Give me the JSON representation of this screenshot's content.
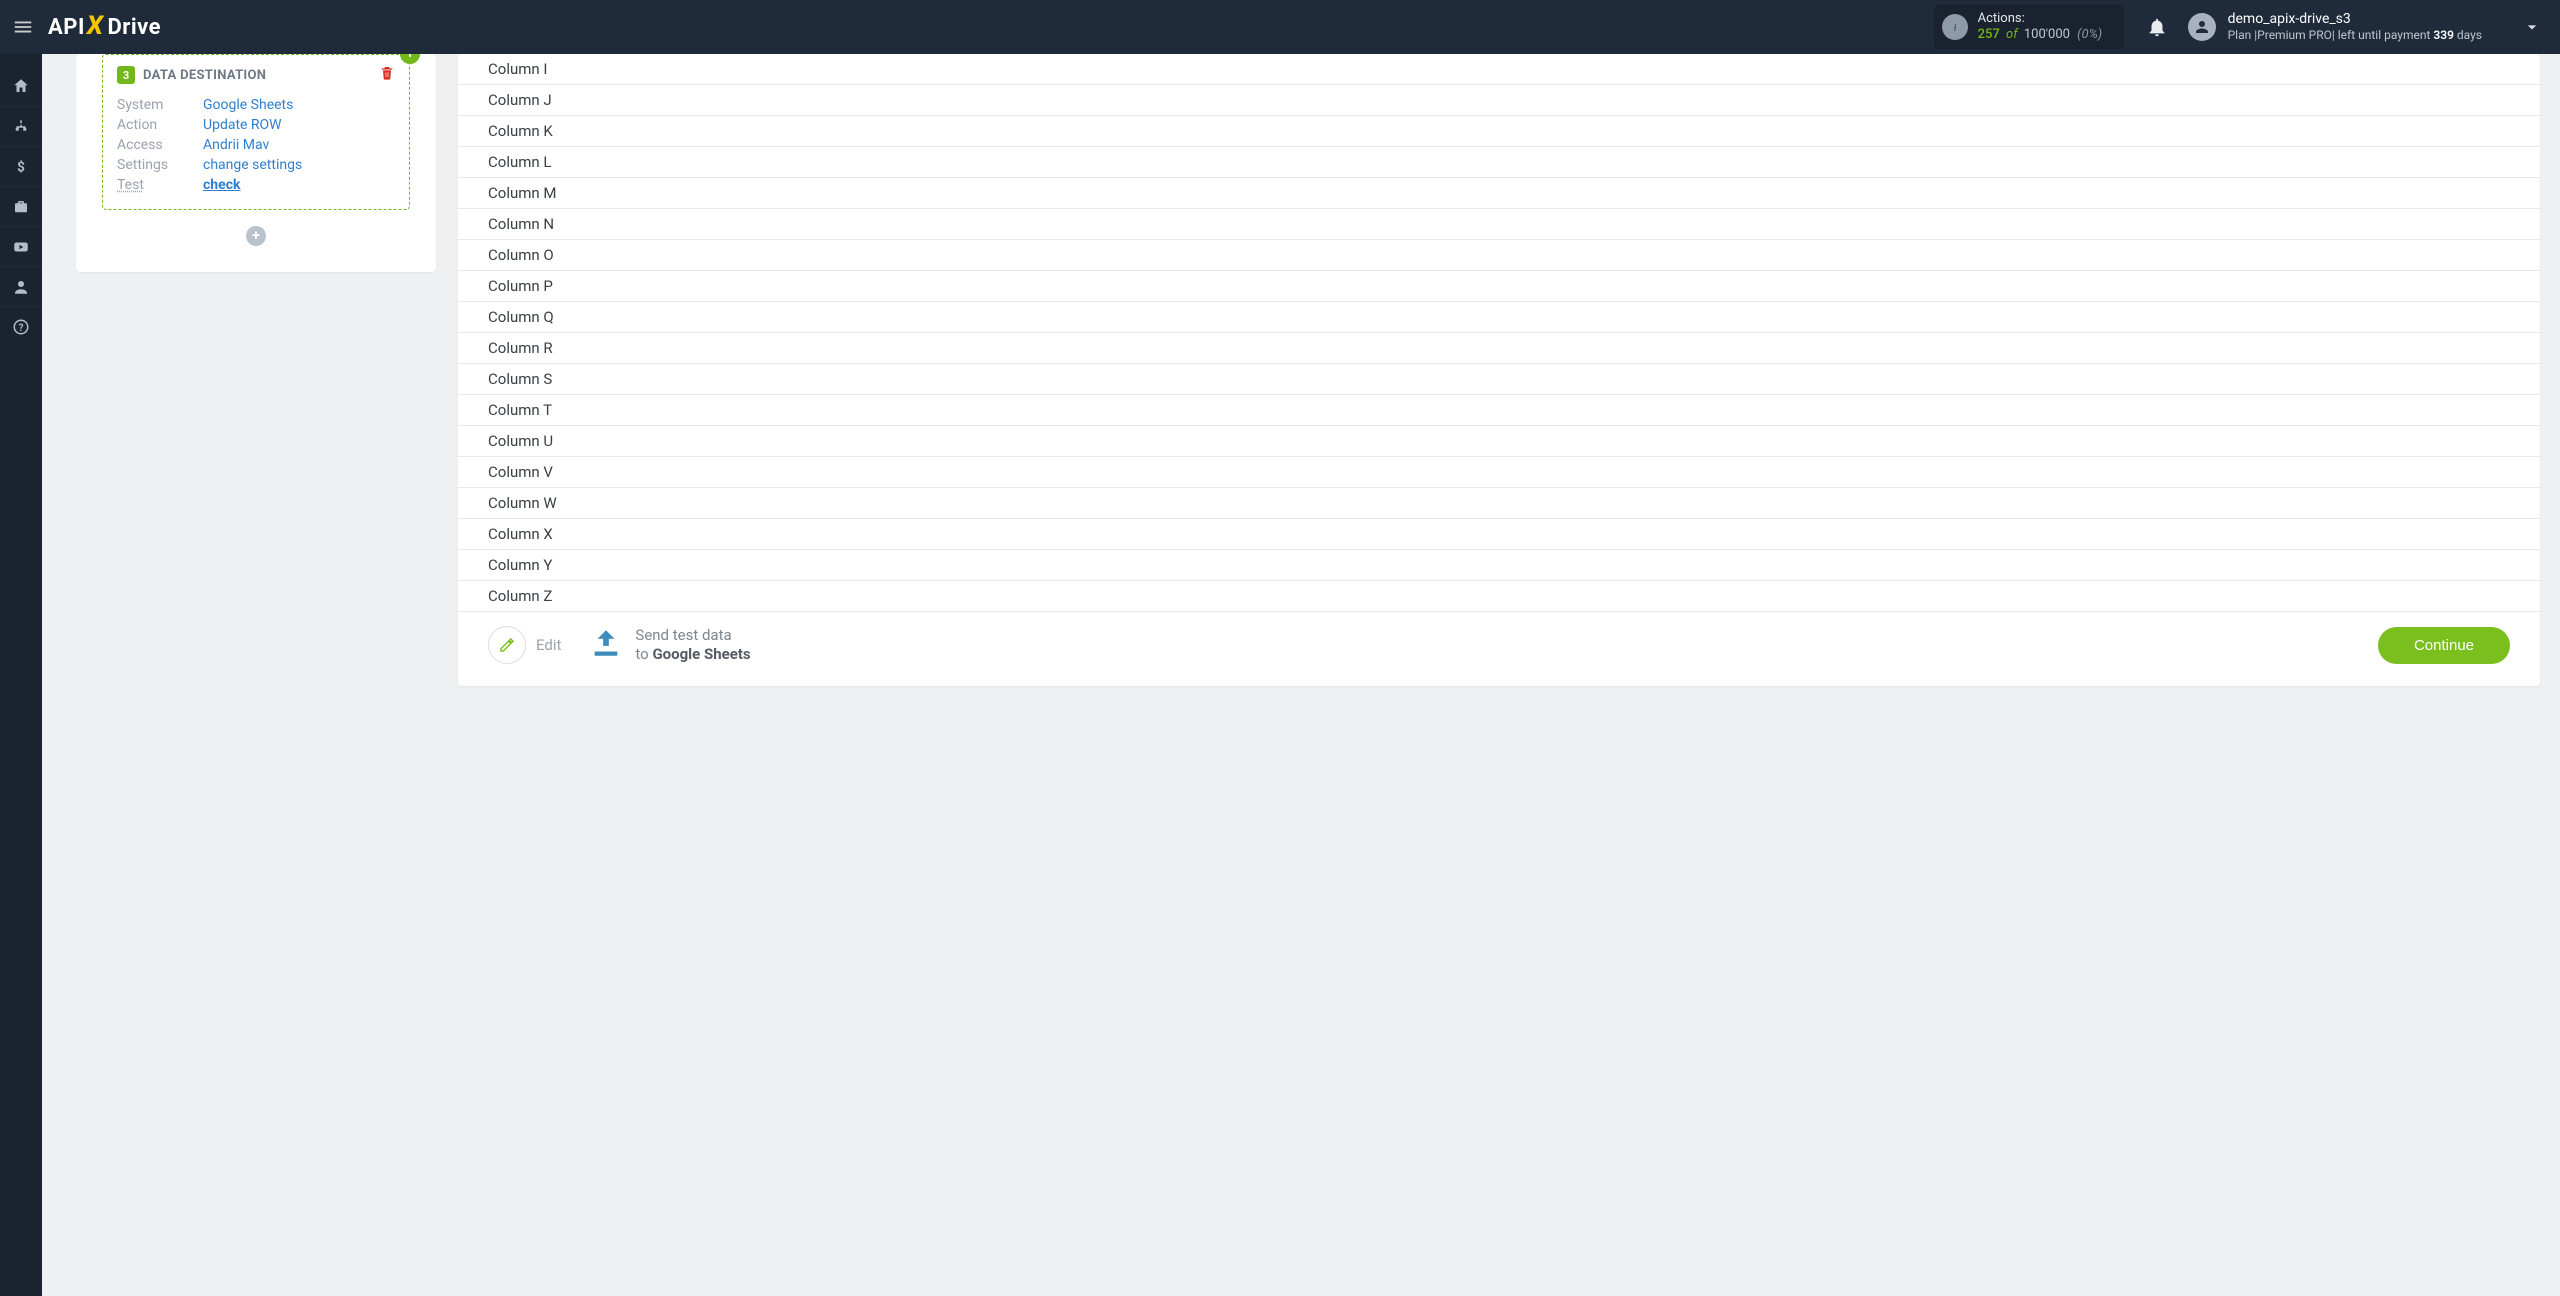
{
  "brand": {
    "part1": "API",
    "part2": "X",
    "part3": "Drive"
  },
  "topbar": {
    "actions_label": "Actions:",
    "actions_count": "257",
    "actions_of": "of",
    "actions_limit": "100'000",
    "actions_pct": "(0%)"
  },
  "user": {
    "name": "demo_apix-drive_s3",
    "plan_prefix": "Plan |",
    "plan_name": "Premium PRO",
    "plan_suffix": "|  left until payment ",
    "days": "339",
    "days_suffix": " days"
  },
  "sidenav": {
    "items": [
      "home",
      "integrations",
      "billing",
      "briefcase",
      "video",
      "account",
      "help"
    ]
  },
  "destination": {
    "step": "3",
    "title": "DATA DESTINATION",
    "rows": {
      "system": {
        "key": "System",
        "value": "Google Sheets"
      },
      "action": {
        "key": "Action",
        "value": "Update ROW"
      },
      "access": {
        "key": "Access",
        "value": "Andrii Mav"
      },
      "settings": {
        "key": "Settings",
        "value": "change settings"
      },
      "test": {
        "key": "Test",
        "value": "check"
      }
    }
  },
  "columns": [
    "Column I",
    "Column J",
    "Column K",
    "Column L",
    "Column M",
    "Column N",
    "Column O",
    "Column P",
    "Column Q",
    "Column R",
    "Column S",
    "Column T",
    "Column U",
    "Column V",
    "Column W",
    "Column X",
    "Column Y",
    "Column Z"
  ],
  "actionbar": {
    "edit": "Edit",
    "send_line1": "Send test data",
    "send_to": "to ",
    "send_dest": "Google Sheets",
    "continue": "Continue"
  }
}
